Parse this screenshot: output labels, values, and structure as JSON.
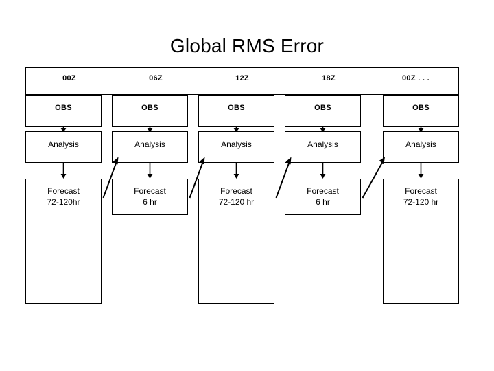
{
  "slide": {
    "title": "Global RMS Error",
    "background_color": "#ffffff",
    "line_color": "#000000"
  },
  "header": {
    "labels": [
      {
        "text": "00Z"
      },
      {
        "text": "06Z"
      },
      {
        "text": "12Z"
      },
      {
        "text": "18Z"
      },
      {
        "text": "00Z . . ."
      }
    ]
  },
  "columns": [
    {
      "cycle": "00Z",
      "obs": "OBS",
      "analysis": "Analysis",
      "forecast": "Forecast\n72-120hr",
      "forecast_size": "tall"
    },
    {
      "cycle": "06Z",
      "obs": "OBS",
      "analysis": "Analysis",
      "forecast": "Forecast\n6 hr",
      "forecast_size": "short"
    },
    {
      "cycle": "12Z",
      "obs": "OBS",
      "analysis": "Analysis",
      "forecast": "Forecast\n72-120 hr",
      "forecast_size": "tall"
    },
    {
      "cycle": "18Z",
      "obs": "OBS",
      "analysis": "Analysis",
      "forecast": "Forecast\n6 hr",
      "forecast_size": "short"
    },
    {
      "cycle": "00Z . . .",
      "obs": "OBS",
      "analysis": "Analysis",
      "forecast": "Forecast\n72-120 hr",
      "forecast_size": "tall"
    }
  ],
  "flow": {
    "obs_to_analysis_arrows": 5,
    "analysis_to_forecast_arrows": 5,
    "forecast_to_next_analysis_arrows": 4,
    "arrow_direction_vertical": "down",
    "arrow_direction_diagonal": "up-right"
  }
}
